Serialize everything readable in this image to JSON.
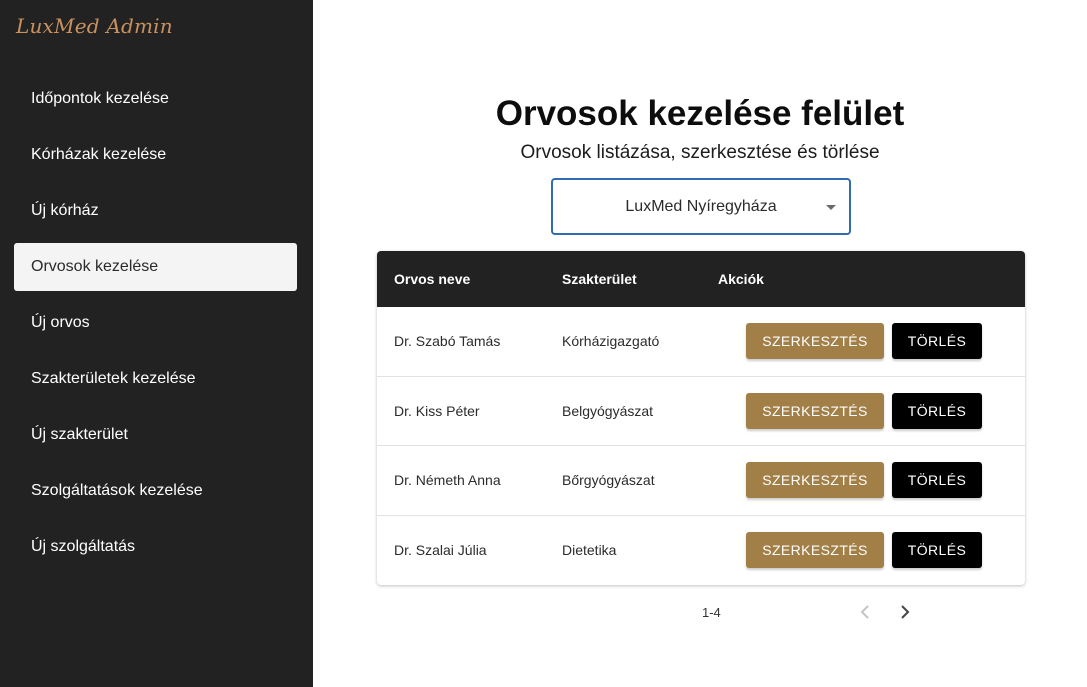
{
  "app": {
    "brand": "LuxMed Admin"
  },
  "sidebar": {
    "items": [
      {
        "label": "Időpontok kezelése",
        "active": false
      },
      {
        "label": "Kórházak kezelése",
        "active": false
      },
      {
        "label": "Új kórház",
        "active": false
      },
      {
        "label": "Orvosok kezelése",
        "active": true
      },
      {
        "label": "Új orvos",
        "active": false
      },
      {
        "label": "Szakterületek kezelése",
        "active": false
      },
      {
        "label": "Új szakterület",
        "active": false
      },
      {
        "label": "Szolgáltatások kezelése",
        "active": false
      },
      {
        "label": "Új szolgáltatás",
        "active": false
      }
    ]
  },
  "main": {
    "title": "Orvosok kezelése felület",
    "subtitle": "Orvosok listázása, szerkesztése és törlése",
    "hospital_select": {
      "value": "LuxMed Nyíregyháza"
    },
    "table": {
      "headers": [
        "Orvos neve",
        "Szakterület",
        "Akciók"
      ],
      "rows": [
        {
          "name": "Dr. Szabó Tamás",
          "specialty": "Kórházigazgató"
        },
        {
          "name": "Dr. Kiss Péter",
          "specialty": "Belgyógyászat"
        },
        {
          "name": "Dr. Németh Anna",
          "specialty": "Bőrgyógyászat"
        },
        {
          "name": "Dr. Szalai Júlia",
          "specialty": "Dietetika"
        }
      ],
      "edit_label": "SZERKESZTÉS",
      "delete_label": "TÖRLÉS"
    },
    "pagination": {
      "range": "1-4"
    }
  },
  "colors": {
    "sidebar_bg": "#222222",
    "brand": "#c9915e",
    "edit_button": "#a27f46",
    "delete_button": "#000000",
    "select_border": "#2f6cb0"
  }
}
